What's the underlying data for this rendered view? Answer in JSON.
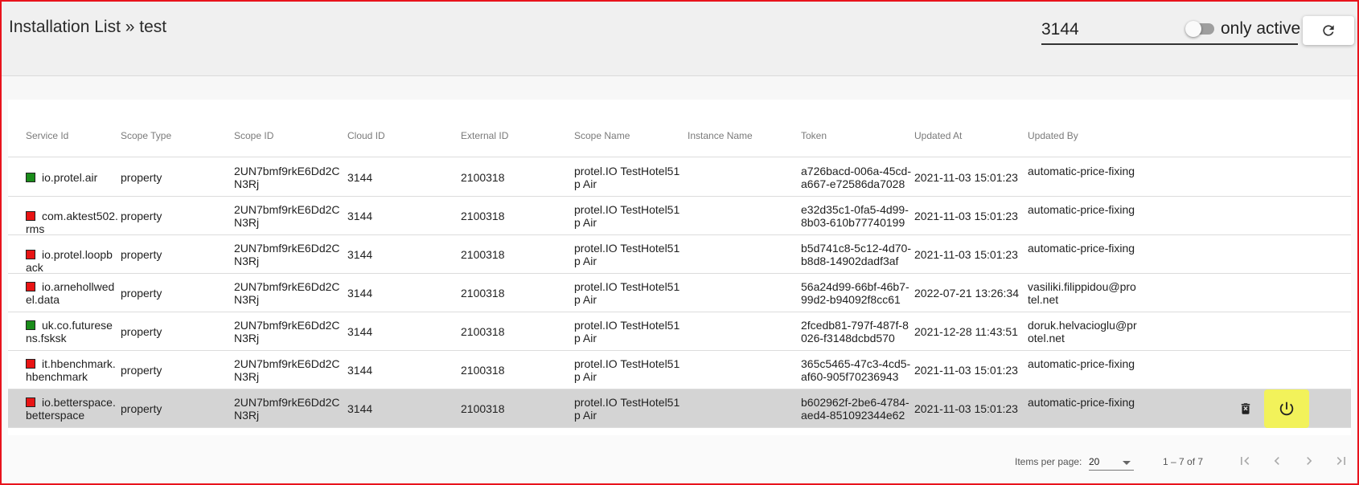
{
  "header": {
    "breadcrumb": "Installation List » test",
    "search_value": "3144",
    "toggle_label": "only active",
    "refresh_icon": "refresh-icon"
  },
  "table": {
    "columns": [
      "Service Id",
      "Scope Type",
      "Scope ID",
      "Cloud ID",
      "External ID",
      "Scope Name",
      "Instance Name",
      "Token",
      "Updated At",
      "Updated By"
    ],
    "rows": [
      {
        "status": "green",
        "service_id": "io.protel.air",
        "scope_type": "property",
        "scope_id": "2UN7bmf9rkE6Dd2CN3Rj",
        "cloud_id": "3144",
        "external_id": "2100318",
        "scope_name": "protel.IO TestHotel51 p Air",
        "instance_name": "",
        "token": "a726bacd-006a-45cd-a667-e72586da7028",
        "updated_at": "2021-11-03 15:01:23",
        "updated_by": "automatic-price-fixing"
      },
      {
        "status": "red",
        "service_id": "com.aktest502.rms",
        "scope_type": "property",
        "scope_id": "2UN7bmf9rkE6Dd2CN3Rj",
        "cloud_id": "3144",
        "external_id": "2100318",
        "scope_name": "protel.IO TestHotel51 p Air",
        "instance_name": "",
        "token": "e32d35c1-0fa5-4d99-8b03-610b77740199",
        "updated_at": "2021-11-03 15:01:23",
        "updated_by": "automatic-price-fixing"
      },
      {
        "status": "red",
        "service_id": "io.protel.loopback",
        "scope_type": "property",
        "scope_id": "2UN7bmf9rkE6Dd2CN3Rj",
        "cloud_id": "3144",
        "external_id": "2100318",
        "scope_name": "protel.IO TestHotel51 p Air",
        "instance_name": "",
        "token": "b5d741c8-5c12-4d70-b8d8-14902dadf3af",
        "updated_at": "2021-11-03 15:01:23",
        "updated_by": "automatic-price-fixing"
      },
      {
        "status": "red",
        "service_id": "io.arnehollwedel.data",
        "scope_type": "property",
        "scope_id": "2UN7bmf9rkE6Dd2CN3Rj",
        "cloud_id": "3144",
        "external_id": "2100318",
        "scope_name": "protel.IO TestHotel51 p Air",
        "instance_name": "",
        "token": "56a24d99-66bf-46b7-99d2-b94092f8cc61",
        "updated_at": "2022-07-21 13:26:34",
        "updated_by": "vasiliki.filippidou@protel.net"
      },
      {
        "status": "green",
        "service_id": "uk.co.futuresens.fsksk",
        "scope_type": "property",
        "scope_id": "2UN7bmf9rkE6Dd2CN3Rj",
        "cloud_id": "3144",
        "external_id": "2100318",
        "scope_name": "protel.IO TestHotel51 p Air",
        "instance_name": "",
        "token": "2fcedb81-797f-487f-8026-f3148dcbd570",
        "updated_at": "2021-12-28 11:43:51",
        "updated_by": "doruk.helvacioglu@protel.net"
      },
      {
        "status": "red",
        "service_id": "it.hbenchmark.hbenchmark",
        "scope_type": "property",
        "scope_id": "2UN7bmf9rkE6Dd2CN3Rj",
        "cloud_id": "3144",
        "external_id": "2100318",
        "scope_name": "protel.IO TestHotel51 p Air",
        "instance_name": "",
        "token": "365c5465-47c3-4cd5-af60-905f70236943",
        "updated_at": "2021-11-03 15:01:23",
        "updated_by": "automatic-price-fixing"
      },
      {
        "status": "red",
        "service_id": "io.betterspace.betterspace",
        "scope_type": "property",
        "scope_id": "2UN7bmf9rkE6Dd2CN3Rj",
        "cloud_id": "3144",
        "external_id": "2100318",
        "scope_name": "protel.IO TestHotel51 p Air",
        "instance_name": "",
        "token": "b602962f-2be6-4784-aed4-851092344e62",
        "updated_at": "2021-11-03 15:01:23",
        "updated_by": "automatic-price-fixing",
        "selected": true
      }
    ]
  },
  "row_actions": {
    "delete_icon": "delete-icon",
    "power_icon": "power-icon"
  },
  "paginator": {
    "items_per_page_label": "Items per page:",
    "page_size": "20",
    "range_label": "1 – 7 of 7",
    "first_icon": "first-page-icon",
    "prev_icon": "chevron-left-icon",
    "next_icon": "chevron-right-icon",
    "last_icon": "last-page-icon"
  },
  "colors": {
    "status_green": "#1a8c1a",
    "status_red": "#e81414",
    "highlight": "#f2f25a",
    "frame_border": "#e8131c"
  }
}
